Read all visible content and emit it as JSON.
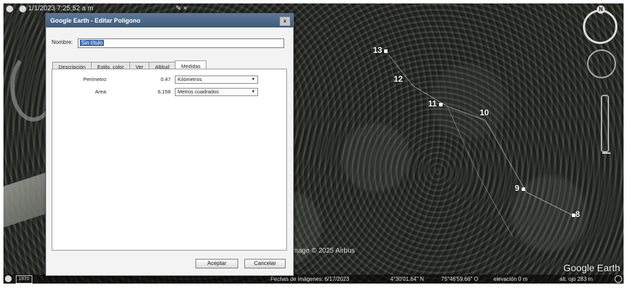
{
  "topbar": {
    "datetime": "1/1/2023  7:25:52 a m",
    "clock_small": "7:25 a m"
  },
  "dialog": {
    "title": "Google Earth - Editar Polígono",
    "close": "x",
    "name_label": "Nombre:",
    "name_value": "Sin título",
    "tabs": [
      "Descripción",
      "Estilo, color",
      "Ver",
      "Altitud",
      "Medidas"
    ],
    "active_tab": "Medidas",
    "perimeter": {
      "label": "Perímetro:",
      "value": "0.47",
      "unit": "Kilómetros"
    },
    "area": {
      "label": "Area:",
      "value": "6,158",
      "unit": "Metros cuadrados"
    },
    "accept": "Aceptar",
    "cancel": "Cancelar"
  },
  "map": {
    "markers": [
      "13",
      "12",
      "11",
      "10",
      "9",
      "8"
    ],
    "watermark": "Image © 2025 Airbus",
    "logo": "Google Earth"
  },
  "statusbar": {
    "year": "1970",
    "image_date": "Fechas de imágenes: 6/17/2023",
    "lat": "4°30'01.64\" N",
    "lon": "75°46'59.66\" O",
    "elevation": "elevación     0 m",
    "eye_alt": "alt. ojo   283 m"
  }
}
